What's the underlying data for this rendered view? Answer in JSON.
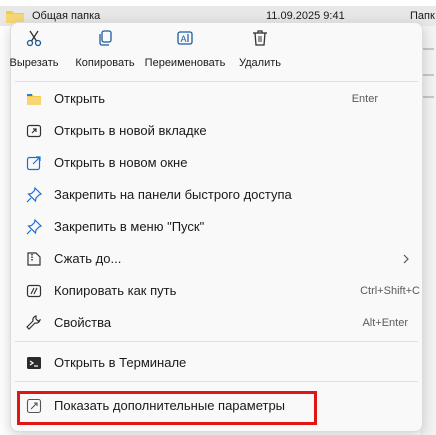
{
  "file_row": {
    "name": "Общая папка",
    "date": "11.09.2025 9:41",
    "type": "Папк"
  },
  "toolbar": [
    {
      "icon": "scissors-icon",
      "label": "Вырезать"
    },
    {
      "icon": "copy-icon",
      "label": "Копировать"
    },
    {
      "icon": "rename-icon",
      "label": "Переименовать"
    },
    {
      "icon": "trash-icon",
      "label": "Удалить"
    }
  ],
  "menu": {
    "open": {
      "label": "Открыть",
      "shortcut": "Enter",
      "icon": "folder-icon"
    },
    "open_new_tab": {
      "label": "Открыть в новой вкладке",
      "icon": "new-tab-icon"
    },
    "open_new_window": {
      "label": "Открыть в новом окне",
      "icon": "new-window-icon"
    },
    "pin_quick_access": {
      "label": "Закрепить на панели быстрого доступа",
      "icon": "pin-icon"
    },
    "pin_start": {
      "label": "Закрепить в меню \"Пуск\"",
      "icon": "pin-icon"
    },
    "compress": {
      "label": "Сжать до...",
      "icon": "zip-icon"
    },
    "copy_path": {
      "label": "Копировать как путь",
      "shortcut": "Ctrl+Shift+C",
      "icon": "path-icon"
    },
    "properties": {
      "label": "Свойства",
      "shortcut": "Alt+Enter",
      "icon": "wrench-icon"
    },
    "terminal": {
      "label": "Открыть в Терминале",
      "icon": "terminal-icon"
    },
    "more_options": {
      "label": "Показать дополнительные параметры",
      "icon": "expand-icon"
    }
  },
  "colors": {
    "accent": "#0067c0",
    "highlight_box": "#e21515"
  }
}
